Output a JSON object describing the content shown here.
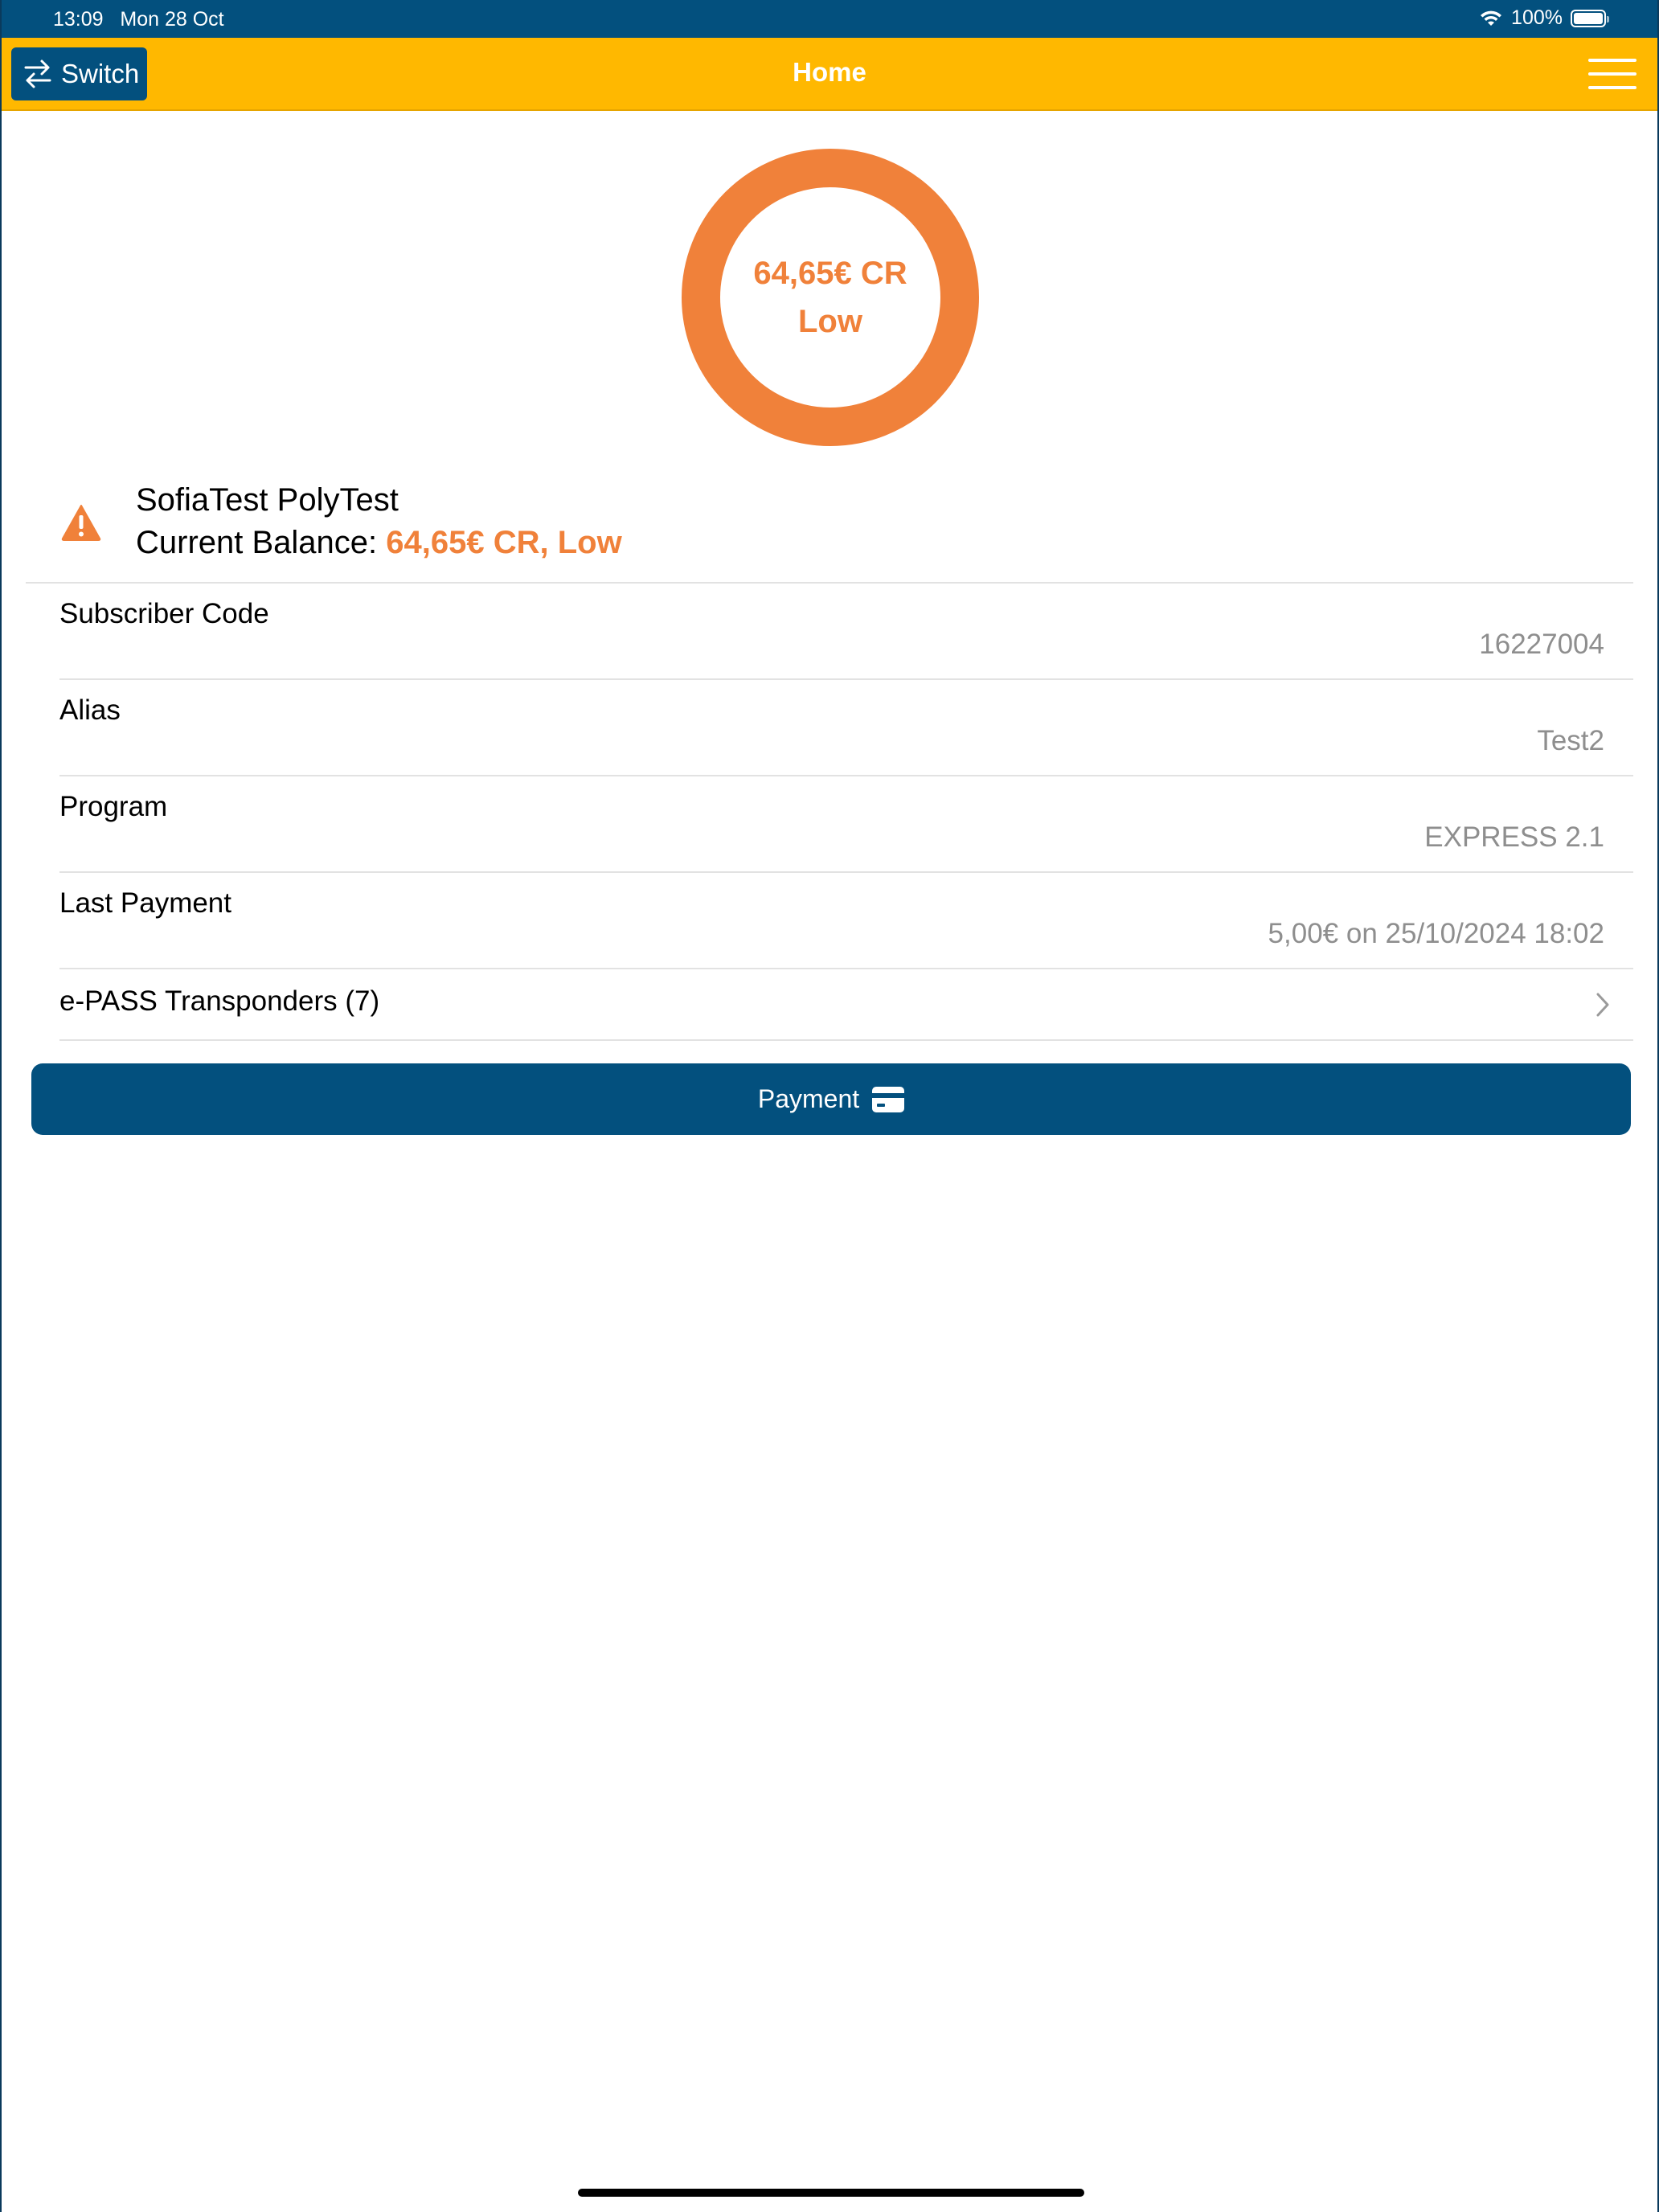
{
  "status_bar": {
    "time": "13:09",
    "date": "Mon 28 Oct",
    "battery": "100%"
  },
  "nav": {
    "switch_label": "Switch",
    "title": "Home"
  },
  "balance_ring": {
    "amount": "64,65€ CR",
    "level": "Low"
  },
  "account": {
    "name": "SofiaTest PolyTest",
    "balance_label": "Current Balance: ",
    "balance_value": "64,65€ CR, Low"
  },
  "info_rows": [
    {
      "label": "Subscriber Code",
      "value": "16227004"
    },
    {
      "label": "Alias",
      "value": "Test2"
    },
    {
      "label": "Program",
      "value": "EXPRESS 2.1"
    },
    {
      "label": "Last Payment",
      "value": "5,00€ on 25/10/2024 18:02"
    }
  ],
  "transponders": {
    "label": "e-PASS Transponders (7)"
  },
  "payment": {
    "label": "Payment"
  },
  "colors": {
    "brand_blue": "#03507e",
    "header_yellow": "#ffb800",
    "warning_orange": "#f0813a"
  },
  "icons": {
    "wifi": "wifi-icon",
    "battery": "battery-icon",
    "switch": "swap-arrows-icon",
    "menu": "hamburger-menu-icon",
    "warning": "warning-triangle-icon",
    "chevron": "chevron-right-icon",
    "card": "credit-card-icon"
  }
}
